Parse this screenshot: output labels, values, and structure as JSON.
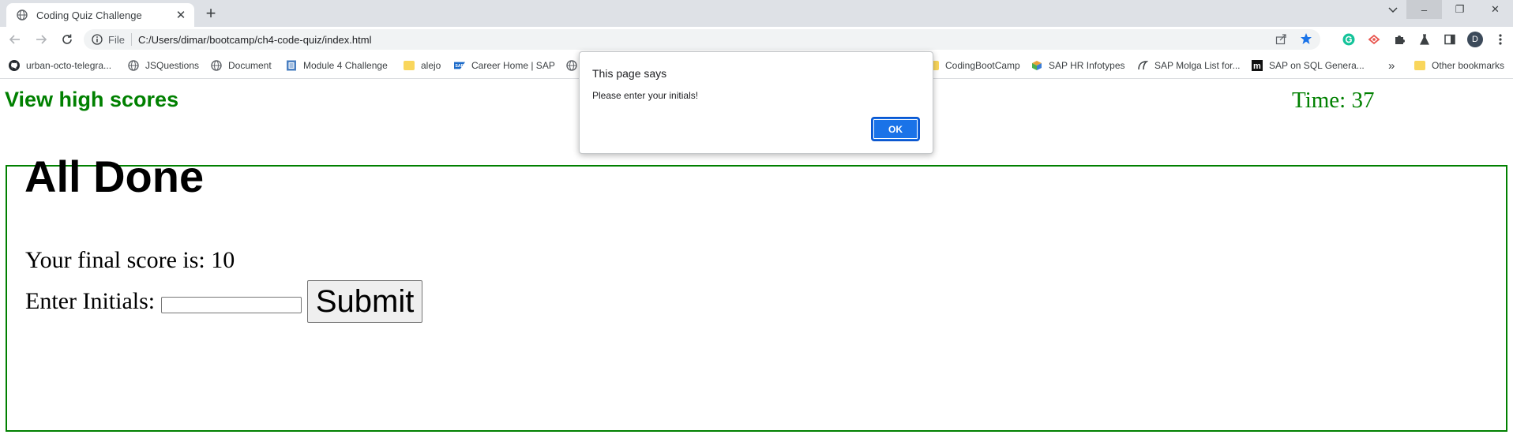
{
  "browser": {
    "tab": {
      "title": "Coding Quiz Challenge",
      "favicon": "globe-icon",
      "close_glyph": "✕"
    },
    "new_tab_glyph": "+",
    "window_controls": {
      "minimize": "–",
      "restore": "❐",
      "close": "✕"
    },
    "toolbar": {
      "file_label": "File",
      "url": "C:/Users/dimar/bootcamp/ch4-code-quiz/index.html"
    },
    "profile_initial": "D",
    "bookmarks": [
      {
        "label": "urban-octo-telegra...",
        "icon": "github-icon"
      },
      {
        "label": "JSQuestions",
        "icon": "globe-icon"
      },
      {
        "label": "Document",
        "icon": "globe-icon"
      },
      {
        "label": "Module 4 Challenge",
        "icon": "doc-icon"
      },
      {
        "label": "alejo",
        "icon": "folder-icon"
      },
      {
        "label": "Career Home | SAP",
        "icon": "sap-icon"
      },
      {
        "label": "",
        "icon": "globe-icon"
      },
      {
        "label": "CodingBootCamp",
        "icon": "folder-icon"
      },
      {
        "label": "SAP HR Infotypes",
        "icon": "cube-icon"
      },
      {
        "label": "SAP Molga List for...",
        "icon": "molga-icon"
      },
      {
        "label": "SAP on SQL Genera...",
        "icon": "m-icon"
      }
    ],
    "more_bookmarks_glyph": "»",
    "other_bookmarks": "Other bookmarks"
  },
  "page": {
    "view_high_scores": "View high scores",
    "timer": "Time: 37",
    "heading": "All Done",
    "final_score": "Your final score is: 10",
    "initials_label": "Enter Initials:",
    "initials_value": "",
    "submit_label": "Submit"
  },
  "dialog": {
    "title": "This page says",
    "message": "Please enter your initials!",
    "ok_label": "OK"
  },
  "colors": {
    "accent_green": "#008000",
    "chrome_tabstrip": "#dee1e6",
    "dialog_button": "#1a73e8"
  }
}
